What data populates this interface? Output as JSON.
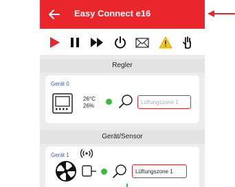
{
  "app": {
    "title": "Easy Connect e16"
  },
  "colors": {
    "accent": "#e8262c",
    "status_ok": "#3dbb3d",
    "link": "#3a58b8"
  },
  "toolbar": {
    "icons": [
      "play-icon",
      "pause-icon",
      "fast-forward-icon",
      "power-icon",
      "mail-icon",
      "warning-icon",
      "hand-icon"
    ]
  },
  "sections": {
    "regler": {
      "header": "Regler",
      "device_label": "Gerät 0",
      "temperature": "26°C",
      "humidity": "26%",
      "zone_placeholder": "Lüftungszone 1"
    },
    "sensor": {
      "header": "Gerät/Sensor",
      "device_label": "Gerät 1",
      "zone_value": "Lüftungszone 1"
    }
  }
}
